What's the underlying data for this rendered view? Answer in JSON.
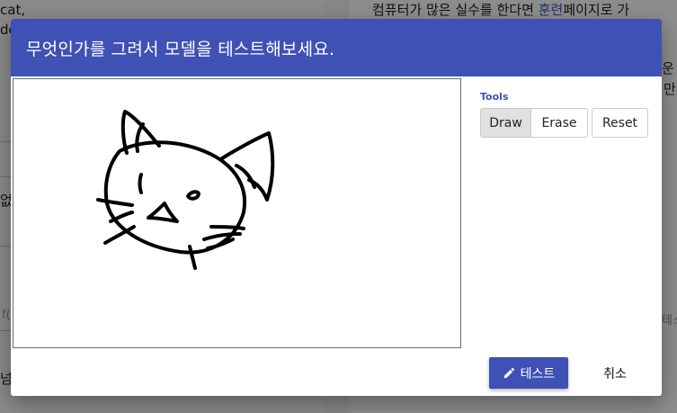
{
  "background": {
    "left_lines": [
      "cat,",
      "do"
    ],
    "left_partial": [
      "없",
      "f("
    ],
    "right_line_1_before": "컴퓨터가 많은 실수를 한다면 ",
    "right_line_1_link": "훈련",
    "right_line_1_after": "페이지로 가",
    "right_frag_1": "운",
    "right_frag_2": "만",
    "right_field_frag": "테스",
    "left_bottom_frag": "넘"
  },
  "dialog": {
    "title": "무엇인가를 그려서 모델을 테스트해보세요.",
    "tools_label": "Tools",
    "tools": {
      "draw": "Draw",
      "erase": "Erase",
      "reset": "Reset"
    },
    "test_label": "테스트",
    "cancel_label": "취소"
  },
  "colors": {
    "primary": "#3f51b5",
    "active_tool": "#e0e0e0"
  },
  "icons": {
    "test_button": "pencil-icon"
  }
}
